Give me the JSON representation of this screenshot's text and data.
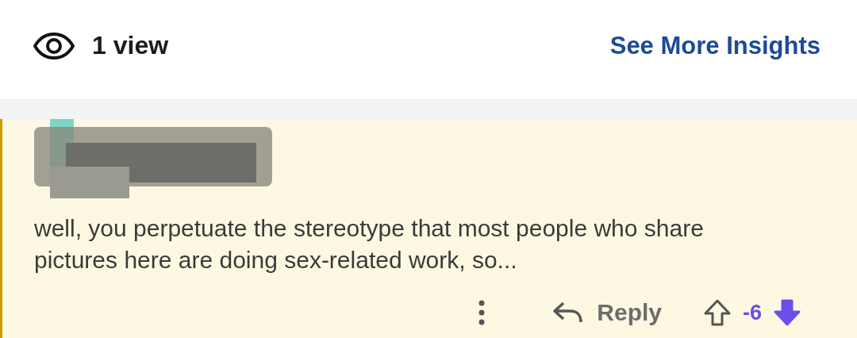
{
  "stats": {
    "views": "1 view",
    "insights_link": "See More Insights"
  },
  "comment": {
    "author_redacted": true,
    "text": "well, you perpetuate the stereotype that most people who share pictures here are doing sex-related work, so...",
    "actions": {
      "reply": "Reply",
      "score": "-6",
      "upvoted": false,
      "downvoted": true
    }
  }
}
